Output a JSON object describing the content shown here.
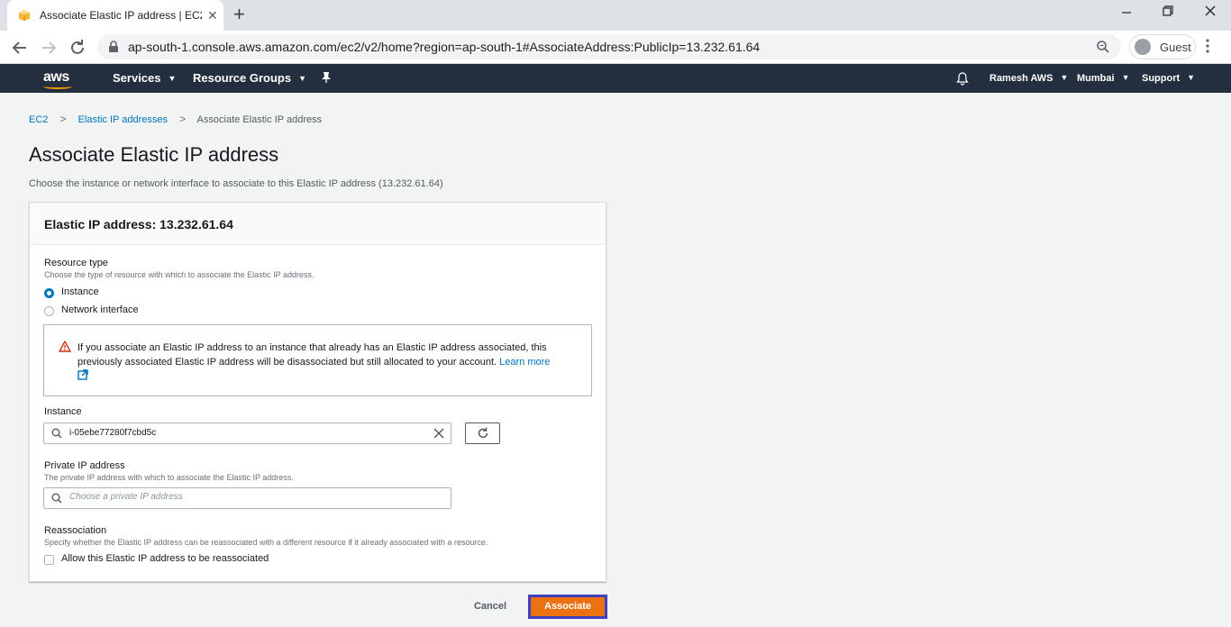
{
  "browser": {
    "tab_title": "Associate Elastic IP address | EC2",
    "tab_close": "✕",
    "new_tab": "+",
    "url": "ap-south-1.console.aws.amazon.com/ec2/v2/home?region=ap-south-1#AssociateAddress:PublicIp=13.232.61.64",
    "profile": "Guest"
  },
  "aws_header": {
    "logo": "aws",
    "services": "Services",
    "resource_groups": "Resource Groups",
    "account": "Ramesh AWS",
    "region": "Mumbai",
    "support": "Support",
    "colors": {
      "nav_bg": "#232f3e",
      "accent": "#ff9900"
    }
  },
  "breadcrumb": {
    "items": [
      "EC2",
      "Elastic IP addresses",
      "Associate Elastic IP address"
    ]
  },
  "page": {
    "title": "Associate Elastic IP address",
    "description": "Choose the instance or network interface to associate to this Elastic IP address (13.232.61.64)"
  },
  "panel": {
    "title": "Elastic IP address: 13.232.61.64",
    "resource_type": {
      "label": "Resource type",
      "description": "Choose the type of resource with which to associate the Elastic IP address.",
      "options": [
        "Instance",
        "Network interface"
      ],
      "selected": "Instance"
    },
    "alert": {
      "text": "If you associate an Elastic IP address to an instance that already has an Elastic IP address associated, this previously associated Elastic IP address will be disassociated but still allocated to your account.",
      "link": "Learn more"
    },
    "instance": {
      "label": "Instance",
      "value": "i-05ebe77280f7cbd5c"
    },
    "private_ip": {
      "label": "Private IP address",
      "description": "The private IP address with which to associate the Elastic IP address.",
      "placeholder": "Choose a private IP address"
    },
    "reassociation": {
      "label": "Reassociation",
      "description": "Specify whether the Elastic IP address can be reassociated with a different resource if it already associated with a resource.",
      "checkbox_label": "Allow this Elastic IP address to be reassociated",
      "checked": false
    }
  },
  "actions": {
    "cancel": "Cancel",
    "associate": "Associate",
    "primary_color": "#ec7211"
  }
}
